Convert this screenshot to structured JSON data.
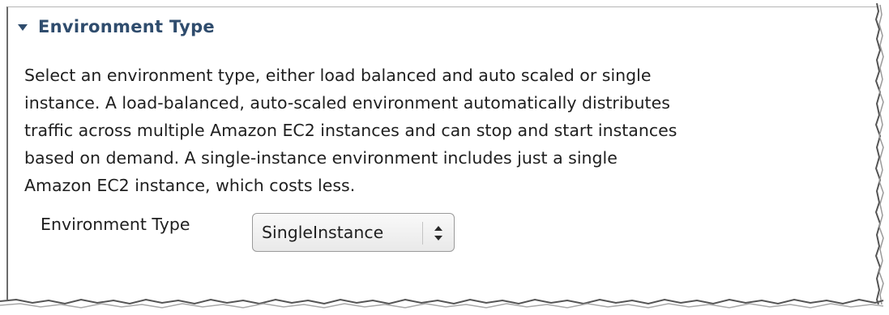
{
  "section": {
    "title": "Environment Type",
    "description": "Select an environment type, either load balanced and auto scaled or single\ninstance. A load-balanced, auto-scaled environment automatically distributes\ntraffic across multiple Amazon EC2 instances and can stop and start instances\nbased on demand. A single-instance environment includes just a single\nAmazon EC2 instance, which costs less."
  },
  "field": {
    "label": "Environment Type",
    "selected_value": "SingleInstance"
  },
  "icons": {
    "collapse": "triangle-down-icon",
    "select": "up-down-arrows-icon"
  },
  "colors": {
    "header": "#2f4c6d",
    "text": "#1f1f1f",
    "border": "#6b6b6b"
  }
}
